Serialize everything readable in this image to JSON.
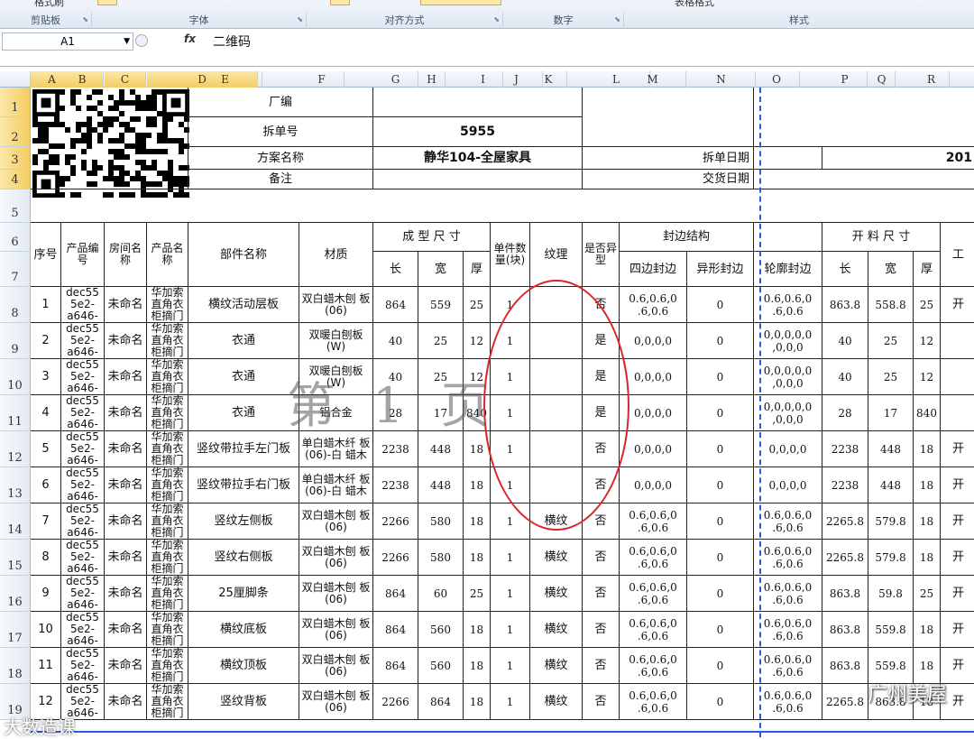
{
  "ribbon": {
    "groups": [
      {
        "label": "剪贴板"
      },
      {
        "label": "字体"
      },
      {
        "label": "对齐方式"
      },
      {
        "label": "数字"
      },
      {
        "label": "样式"
      }
    ],
    "top_partial": [
      "格式刷",
      "表格格式"
    ]
  },
  "formula_bar": {
    "cell_ref": "A1",
    "fx": "fx",
    "value": "二维码"
  },
  "columns": [
    "A",
    "B",
    "C",
    "D",
    "E",
    "F",
    "G",
    "H",
    "I",
    "J",
    "K",
    "L",
    "M",
    "N",
    "O",
    "P",
    "Q",
    "R"
  ],
  "rows": [
    "1",
    "2",
    "3",
    "4",
    "5",
    "6",
    "7",
    "8",
    "9",
    "10",
    "11",
    "12",
    "13",
    "14",
    "15",
    "16",
    "17",
    "18",
    "19"
  ],
  "header": {
    "factory": "厂编",
    "split_no_label": "拆单号",
    "split_no": "5955",
    "plan_label": "方案名称",
    "plan_name": "静华104-全屋家具",
    "remark_label": "备注",
    "split_date_label": "拆单日期",
    "delivery_date_label": "交货日期",
    "date_partial": "201"
  },
  "table_head": {
    "seq": "序号",
    "product_code": "产品编号",
    "room_name": "房间名称",
    "product_name": "产品名称",
    "part_name": "部件名称",
    "material": "材质",
    "molding_size": "成 型 尺 寸",
    "len": "长",
    "wid": "宽",
    "thk": "厚",
    "qty": "单件数量(块)",
    "texture": "纹理",
    "irregular": "是否异型",
    "edge_struct": "封边结构",
    "four_edge": "四边封边",
    "irr_edge": "异形封边",
    "contour_edge": "轮廓封边",
    "cut_size": "开 料 尺 寸",
    "cut_len": "长",
    "cut_wid": "宽",
    "cut_thk": "厚",
    "extra": "工"
  },
  "table_rows": [
    {
      "seq": "1",
      "code": "dec55 5e2- a646-",
      "room": "未命名",
      "prod": "华加索 直角衣 柜摘门",
      "part": "横纹活动层板",
      "mat": "双白蜡木刨 板(06)",
      "l": "864",
      "w": "559",
      "t": "25",
      "q": "1",
      "tex": "",
      "irr": "否",
      "edge": "0.6,0.6,0 .6,0.6",
      "irre": "0",
      "cont": "0.6,0.6,0 .6,0.6",
      "cl": "863.8",
      "cw": "558.8",
      "ct": "25",
      "x": "开"
    },
    {
      "seq": "2",
      "code": "dec55 5e2- a646-",
      "room": "未命名",
      "prod": "华加索 直角衣 柜摘门",
      "part": "衣通",
      "mat": "双暖白刨板 (W)",
      "l": "40",
      "w": "25",
      "t": "12",
      "q": "1",
      "tex": "",
      "irr": "是",
      "edge": "0,0,0,0",
      "irre": "0",
      "cont": "0,0,0,0,0 ,0,0,0",
      "cl": "40",
      "cw": "25",
      "ct": "12",
      "x": ""
    },
    {
      "seq": "3",
      "code": "dec55 5e2- a646-",
      "room": "未命名",
      "prod": "华加索 直角衣 柜摘门",
      "part": "衣通",
      "mat": "双暖白刨板 (W)",
      "l": "40",
      "w": "25",
      "t": "12",
      "q": "1",
      "tex": "",
      "irr": "是",
      "edge": "0,0,0,0",
      "irre": "0",
      "cont": "0,0,0,0,0 ,0,0,0",
      "cl": "40",
      "cw": "25",
      "ct": "12",
      "x": ""
    },
    {
      "seq": "4",
      "code": "dec55 5e2- a646-",
      "room": "未命名",
      "prod": "华加索 直角衣 柜摘门",
      "part": "衣通",
      "mat": "铝合金",
      "l": "28",
      "w": "17",
      "t": "840",
      "q": "1",
      "tex": "",
      "irr": "是",
      "edge": "0,0,0,0",
      "irre": "0",
      "cont": "0,0,0,0,0 ,0,0,0",
      "cl": "28",
      "cw": "17",
      "ct": "840",
      "x": ""
    },
    {
      "seq": "5",
      "code": "dec55 5e2- a646-",
      "room": "未命名",
      "prod": "华加索 直角衣 柜摘门",
      "part": "竖纹带拉手左门板",
      "mat": "单白蜡木纤 板(06)-白 蜡木",
      "l": "2238",
      "w": "448",
      "t": "18",
      "q": "1",
      "tex": "",
      "irr": "否",
      "edge": "0,0,0,0",
      "irre": "0",
      "cont": "0,0,0,0",
      "cl": "2238",
      "cw": "448",
      "ct": "18",
      "x": "开"
    },
    {
      "seq": "6",
      "code": "dec55 5e2- a646-",
      "room": "未命名",
      "prod": "华加索 直角衣 柜摘门",
      "part": "竖纹带拉手右门板",
      "mat": "单白蜡木纤 板(06)-白 蜡木",
      "l": "2238",
      "w": "448",
      "t": "18",
      "q": "1",
      "tex": "",
      "irr": "否",
      "edge": "0,0,0,0",
      "irre": "0",
      "cont": "0,0,0,0",
      "cl": "2238",
      "cw": "448",
      "ct": "18",
      "x": "开"
    },
    {
      "seq": "7",
      "code": "dec55 5e2- a646-",
      "room": "未命名",
      "prod": "华加索 直角衣 柜摘门",
      "part": "竖纹左侧板",
      "mat": "双白蜡木刨 板(06)",
      "l": "2266",
      "w": "580",
      "t": "18",
      "q": "1",
      "tex": "横纹",
      "irr": "否",
      "edge": "0.6,0.6,0 .6,0.6",
      "irre": "0",
      "cont": "0.6,0.6,0 .6,0.6",
      "cl": "2265.8",
      "cw": "579.8",
      "ct": "18",
      "x": "开"
    },
    {
      "seq": "8",
      "code": "dec55 5e2- a646-",
      "room": "未命名",
      "prod": "华加索 直角衣 柜摘门",
      "part": "竖纹右侧板",
      "mat": "双白蜡木刨 板(06)",
      "l": "2266",
      "w": "580",
      "t": "18",
      "q": "1",
      "tex": "横纹",
      "irr": "否",
      "edge": "0.6,0.6,0 .6,0.6",
      "irre": "0",
      "cont": "0.6,0.6,0 .6,0.6",
      "cl": "2265.8",
      "cw": "579.8",
      "ct": "18",
      "x": "开"
    },
    {
      "seq": "9",
      "code": "dec55 5e2- a646-",
      "room": "未命名",
      "prod": "华加索 直角衣 柜摘门",
      "part": "25厘脚条",
      "mat": "双白蜡木刨 板(06)",
      "l": "864",
      "w": "60",
      "t": "25",
      "q": "1",
      "tex": "横纹",
      "irr": "否",
      "edge": "0.6,0.6,0 .6,0.6",
      "irre": "0",
      "cont": "0.6,0.6,0 .6,0.6",
      "cl": "863.8",
      "cw": "59.8",
      "ct": "25",
      "x": "开"
    },
    {
      "seq": "10",
      "code": "dec55 5e2- a646-",
      "room": "未命名",
      "prod": "华加索 直角衣 柜摘门",
      "part": "横纹底板",
      "mat": "双白蜡木刨 板(06)",
      "l": "864",
      "w": "560",
      "t": "18",
      "q": "1",
      "tex": "横纹",
      "irr": "否",
      "edge": "0.6,0.6,0 .6,0.6",
      "irre": "0",
      "cont": "0.6,0.6,0 .6,0.6",
      "cl": "863.8",
      "cw": "559.8",
      "ct": "18",
      "x": "开"
    },
    {
      "seq": "11",
      "code": "dec55 5e2- a646-",
      "room": "未命名",
      "prod": "华加索 直角衣 柜摘门",
      "part": "横纹顶板",
      "mat": "双白蜡木刨 板(06)",
      "l": "864",
      "w": "560",
      "t": "18",
      "q": "1",
      "tex": "横纹",
      "irr": "否",
      "edge": "0.6,0.6,0 .6,0.6",
      "irre": "0",
      "cont": "0.6,0.6,0 .6,0.6",
      "cl": "863.8",
      "cw": "559.8",
      "ct": "18",
      "x": "开"
    },
    {
      "seq": "12",
      "code": "dec55 5e2- a646-",
      "room": "未命名",
      "prod": "华加索 直角衣 柜摘门",
      "part": "竖纹背板",
      "mat": "双白蜡木刨 板(06)",
      "l": "2266",
      "w": "864",
      "t": "18",
      "q": "1",
      "tex": "横纹",
      "irr": "否",
      "edge": "0.6,0.6,0 .6,0.6",
      "irre": "0",
      "cont": "0.6,0.6,0 .6,0.6",
      "cl": "2265.8",
      "cw": "863.8",
      "ct": "18",
      "x": "开"
    }
  ],
  "overlay": {
    "page_watermark": "第 1 页",
    "logo_right": "广州美屋",
    "logo_left": "大数造课"
  },
  "colors": {
    "page_break": "#2a5bd7",
    "annotation": "#d9262a",
    "selected_header": "#f5cd61"
  }
}
